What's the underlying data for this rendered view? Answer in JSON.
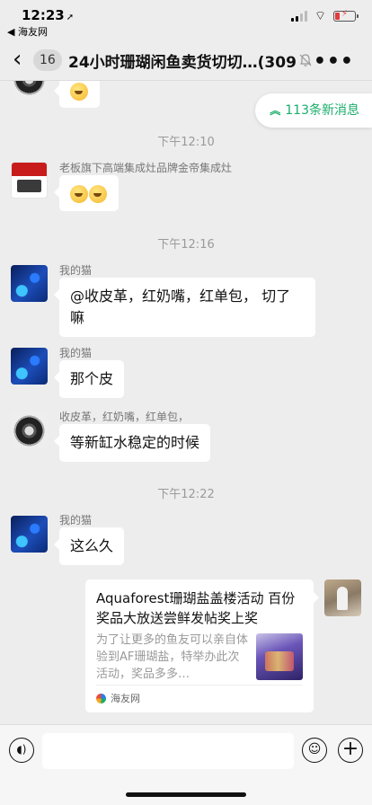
{
  "status": {
    "time": "12:23",
    "back_app": "◀ 海友网"
  },
  "nav": {
    "unread_count": "16",
    "title": "24小时珊瑚闲鱼卖货切切…(309)"
  },
  "new_messages": "113条新消息",
  "timestamps": [
    "下午12:10",
    "下午12:16",
    "下午12:22"
  ],
  "senders": {
    "stove": "老板旗下高端集成灶品牌金帝集成灶",
    "cat": "我的猫",
    "leather": "收皮革，红奶嘴，红单包，"
  },
  "messages": [
    {
      "id": "m1",
      "text": "@收皮革，红奶嘴，红单包， 切了嘛"
    },
    {
      "id": "m2",
      "text": "那个皮"
    },
    {
      "id": "m3",
      "text": "等新缸水稳定的时候"
    },
    {
      "id": "m4",
      "text": "这么久"
    }
  ],
  "card": {
    "title": "Aquaforest珊瑚盐盖楼活动 百份奖品大放送尝鲜发帖奖上奖",
    "description": "为了让更多的鱼友可以亲自体验到AF珊瑚盐，特举办此次活动，奖品多多…",
    "source": "海友网"
  },
  "icons": {
    "mute": "mute-bell-icon",
    "more": "more-icon",
    "voice": "voice-icon",
    "emoji": "emoji-icon",
    "plus": "plus-icon"
  },
  "colors": {
    "accent_green": "#1aad6a",
    "background": "#ededed",
    "bubble": "#ffffff",
    "battery_low": "#e23c3c"
  }
}
